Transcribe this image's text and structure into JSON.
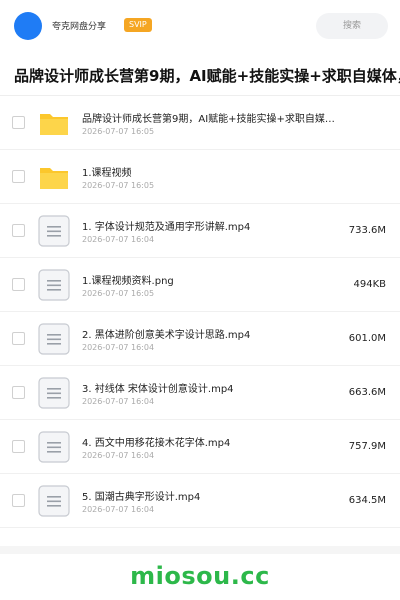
{
  "header": {
    "user_name": "夸克网盘分享",
    "badge": "SVIP",
    "search_label": "搜索"
  },
  "folder_title": "品牌设计师成长营第9期，AI赋能+技能实操+求职自媒体，",
  "files": [
    {
      "name": "品牌设计师成长营第9期，AI赋能+技能实操+求职自媒体…",
      "date": "2026-07-07 16:05",
      "size": "",
      "type": "folder",
      "icon": "folder-icon"
    },
    {
      "name": "1.课程视频",
      "date": "2026-07-07 16:05",
      "size": "",
      "type": "folder",
      "icon": "folder-icon"
    },
    {
      "name": "1. 字体设计规范及通用字形讲解.mp4",
      "date": "2026-07-07 16:04",
      "size": "733.6M",
      "type": "file",
      "icon": "document-icon"
    },
    {
      "name": "1.课程视频资料.png",
      "date": "2026-07-07 16:05",
      "size": "494KB",
      "type": "file",
      "icon": "document-icon"
    },
    {
      "name": "2. 黑体进阶创意美术字设计思路.mp4",
      "date": "2026-07-07 16:04",
      "size": "601.0M",
      "type": "file",
      "icon": "document-icon"
    },
    {
      "name": "3. 衬线体 宋体设计创意设计.mp4",
      "date": "2026-07-07 16:04",
      "size": "663.6M",
      "type": "file",
      "icon": "document-icon"
    },
    {
      "name": "4. 西文中用移花接木花字体.mp4",
      "date": "2026-07-07 16:04",
      "size": "757.9M",
      "type": "file",
      "icon": "document-icon"
    },
    {
      "name": "5. 国潮古典字形设计.mp4",
      "date": "2026-07-07 16:04",
      "size": "634.5M",
      "type": "file",
      "icon": "document-icon"
    }
  ],
  "watermark": "miosou.cc",
  "colors": {
    "avatar": "#1f7cf5",
    "svip_badge": "#f5a623",
    "folder": "#fcc72c",
    "watermark": "#2db84a"
  }
}
